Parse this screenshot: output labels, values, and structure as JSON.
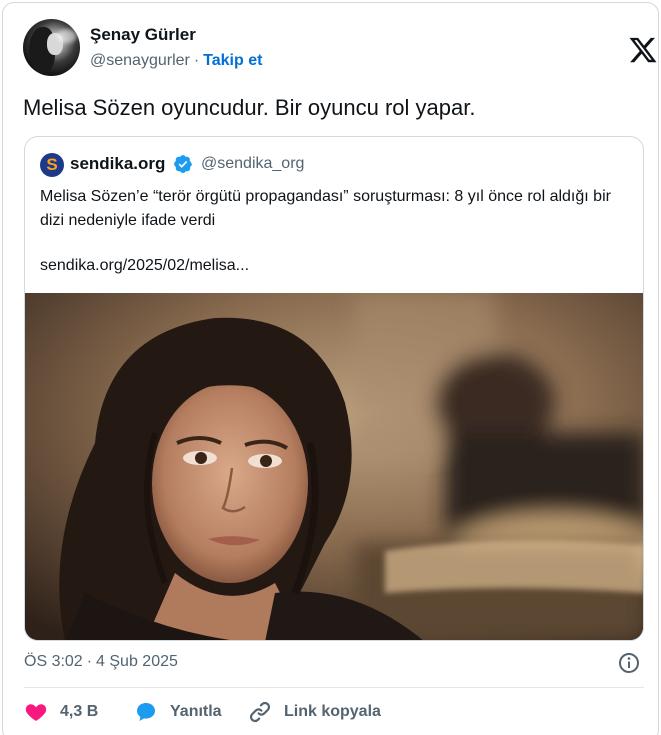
{
  "author": {
    "name": "Şenay Gürler",
    "handle": "@senaygurler",
    "separator": "·",
    "follow_label": "Takip et"
  },
  "tweet": {
    "text": "Melisa Sözen oyuncudur. Bir oyuncu rol yapar."
  },
  "quote": {
    "logo_letter": "S",
    "source_name": "sendika.org",
    "source_handle": "@sendika_org",
    "body": "Melisa Sözen’e “terör örgütü propagandası” soruşturması: 8 yıl önce rol aldığı bir dizi nedeniyle ifade verdi",
    "link": "sendika.org/2025/02/melisa..."
  },
  "meta": {
    "time": "ÖS 3:02",
    "separator": "·",
    "date": "4 Şub 2025"
  },
  "actions": {
    "like_count": "4,3 B",
    "reply_label": "Yanıtla",
    "copy_link_label": "Link kopyala"
  },
  "colors": {
    "like": "#f91880",
    "reply": "#1d9bf0",
    "follow": "#006fd6",
    "verified": "#1d9bf0",
    "secondary_text": "#536471"
  },
  "icons": [
    "x-logo-icon",
    "verified-badge-icon",
    "info-icon",
    "heart-icon",
    "reply-bubble-icon",
    "link-icon"
  ]
}
